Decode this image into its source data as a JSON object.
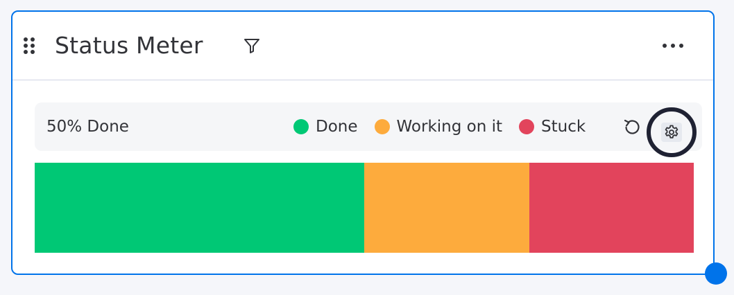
{
  "widget": {
    "title": "Status Meter",
    "icons": {
      "drag": "drag-handle-icon",
      "filter": "filter-icon",
      "more": "more-options-icon",
      "reset": "reset-icon",
      "settings": "settings-gear-icon"
    }
  },
  "toolbar": {
    "summary": "50% Done"
  },
  "legend": [
    {
      "label": "Done",
      "color": "#00c875"
    },
    {
      "label": "Working on it",
      "color": "#fdab3d"
    },
    {
      "label": "Stuck",
      "color": "#e2445c"
    }
  ],
  "meter": {
    "segments": [
      {
        "status": "Done",
        "fraction": 0.5,
        "color": "#00c875"
      },
      {
        "status": "Working on it",
        "fraction": 0.25,
        "color": "#fdab3d"
      },
      {
        "status": "Stuck",
        "fraction": 0.25,
        "color": "#e2445c"
      }
    ]
  },
  "colors": {
    "accent": "#0073ea",
    "focus_ring": "#1f2233"
  }
}
